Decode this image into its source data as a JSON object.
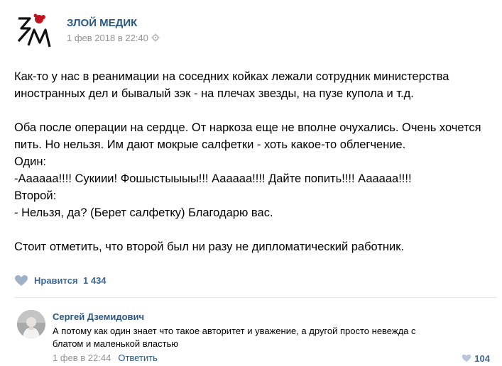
{
  "post": {
    "author": "ЗЛОЙ МЕДИК",
    "date": "1 фев 2018 в 22:40",
    "logo_text": "ЗМ",
    "paragraphs": [
      {
        "lines": [
          "Как-то у нас в реанимации на соседних койках лежали сотрудник министерства",
          "иностранных дел и бывалый зэк - на плечах звезды, на пузе купола и т.д."
        ]
      },
      {
        "lines": [
          "Оба после операции на сердце. От наркоза еще не вполне очухались. Очень хочется",
          "пить. Но нельзя. Им дают мокрые салфетки - хоть какое-то облегчение.",
          "Один:",
          "-Аааааа!!!! Сукиии! Фошыстыыыы!!! Аааааа!!!! Дайте попить!!!! Аааааа!!!!",
          "Второй:",
          "- Нельзя, да? (Берет салфетку) Благодарю вас."
        ]
      },
      {
        "lines": [
          "Стоит отметить, что второй был ни разу не дипломатический работник."
        ]
      }
    ],
    "likes_label": "Нравится",
    "likes_count": "1 434"
  },
  "comment": {
    "author": "Сергей Дземидович",
    "text_lines": [
      "А потому как один знает что такое авторитет и уважение, а другой просто невежда с",
      "блатом и маленькой властью"
    ],
    "date": "1 фев в 22:44",
    "reply_label": "Ответить",
    "likes_count": "104"
  },
  "colors": {
    "link": "#2a5885",
    "muted": "#939393",
    "accent_red": "#c0131e"
  }
}
